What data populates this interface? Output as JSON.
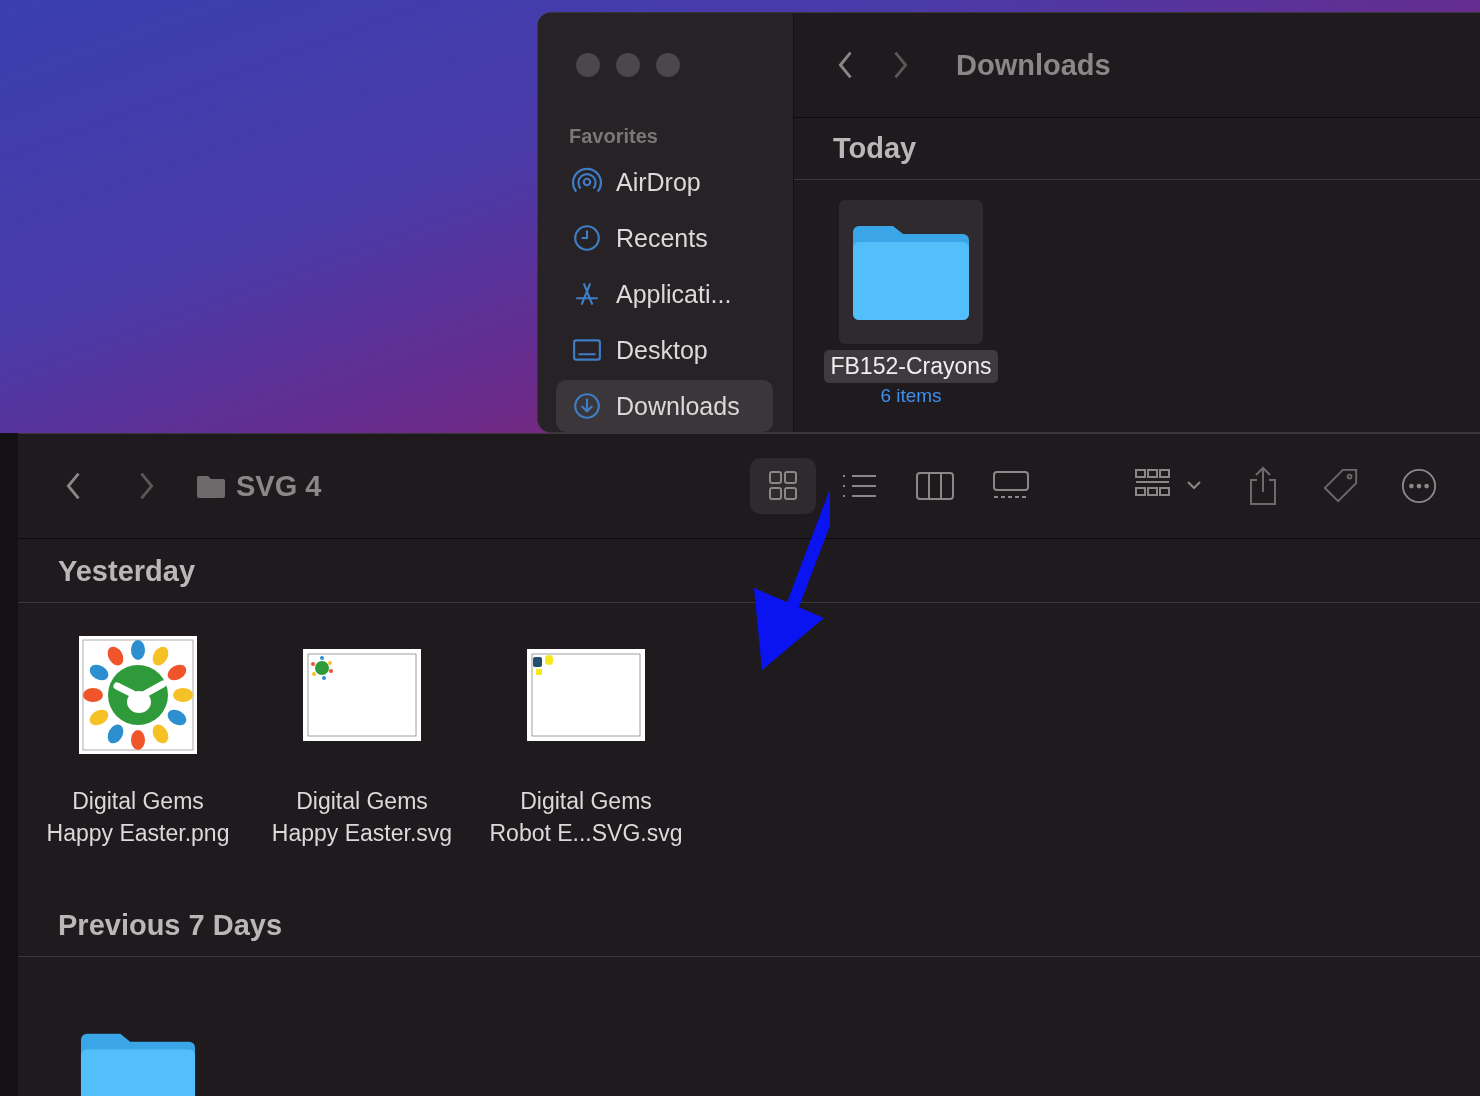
{
  "downloads_window": {
    "title": "Downloads",
    "sidebar": {
      "heading": "Favorites",
      "items": [
        {
          "label": "AirDrop",
          "kind": "airdrop",
          "selected": false
        },
        {
          "label": "Recents",
          "kind": "clock",
          "selected": false
        },
        {
          "label": "Applicati...",
          "kind": "apps",
          "selected": false
        },
        {
          "label": "Desktop",
          "kind": "desktop",
          "selected": false
        },
        {
          "label": "Downloads",
          "kind": "download",
          "selected": true
        }
      ]
    },
    "sections": [
      {
        "heading": "Today",
        "items": [
          {
            "name": "FB152-Crayons",
            "detail": "6 items",
            "selected": true
          }
        ]
      }
    ]
  },
  "svg4_window": {
    "title": "SVG 4",
    "view_modes": [
      {
        "kind": "icons",
        "selected": true
      },
      {
        "kind": "list",
        "selected": false
      },
      {
        "kind": "columns",
        "selected": false
      },
      {
        "kind": "gallery",
        "selected": false
      }
    ],
    "sections": [
      {
        "heading": "Yesterday",
        "items": [
          {
            "kind": "easter",
            "name_lines": [
              "Digital Gems",
              "Happy Easter.png"
            ]
          },
          {
            "kind": "easter-small",
            "name_lines": [
              "Digital Gems",
              "Happy Easter.svg"
            ]
          },
          {
            "kind": "robot-small",
            "name_lines": [
              "Digital Gems",
              "Robot E...SVG.svg"
            ]
          }
        ]
      },
      {
        "heading": "Previous 7 Days",
        "items": [
          {
            "kind": "folder"
          }
        ]
      }
    ]
  }
}
